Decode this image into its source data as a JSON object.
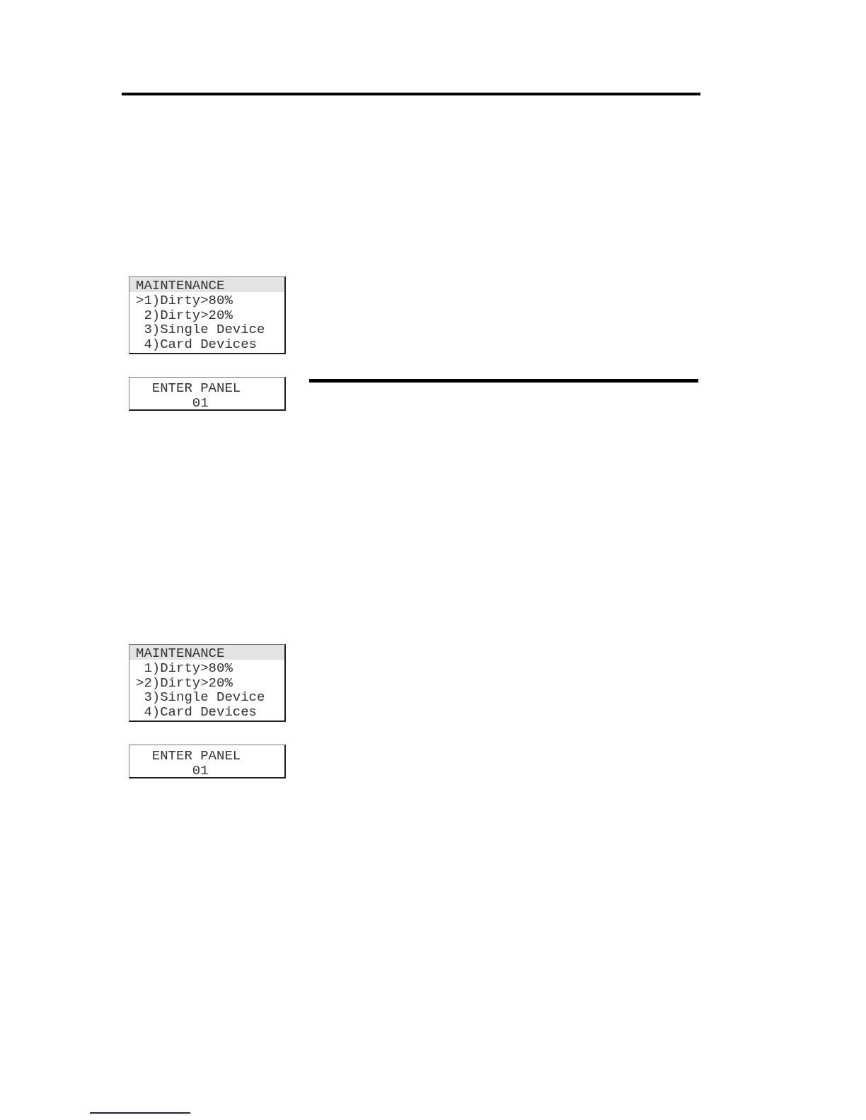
{
  "screens": [
    {
      "menu": {
        "title": "MAINTENANCE",
        "cursor": ">",
        "items": [
          {
            "label": "1)Dirty>80%",
            "selected": true
          },
          {
            "label": "2)Dirty>20%",
            "selected": false
          },
          {
            "label": "3)Single Device",
            "selected": false
          },
          {
            "label": "4)Card Devices",
            "selected": false
          }
        ]
      },
      "prompt": {
        "label": "ENTER PANEL",
        "value": "01"
      }
    },
    {
      "menu": {
        "title": "MAINTENANCE",
        "cursor": ">",
        "items": [
          {
            "label": "1)Dirty>80%",
            "selected": false
          },
          {
            "label": "2)Dirty>20%",
            "selected": true
          },
          {
            "label": "3)Single Device",
            "selected": false
          },
          {
            "label": "4)Card Devices",
            "selected": false
          }
        ]
      },
      "prompt": {
        "label": "ENTER PANEL",
        "value": "01"
      }
    }
  ]
}
